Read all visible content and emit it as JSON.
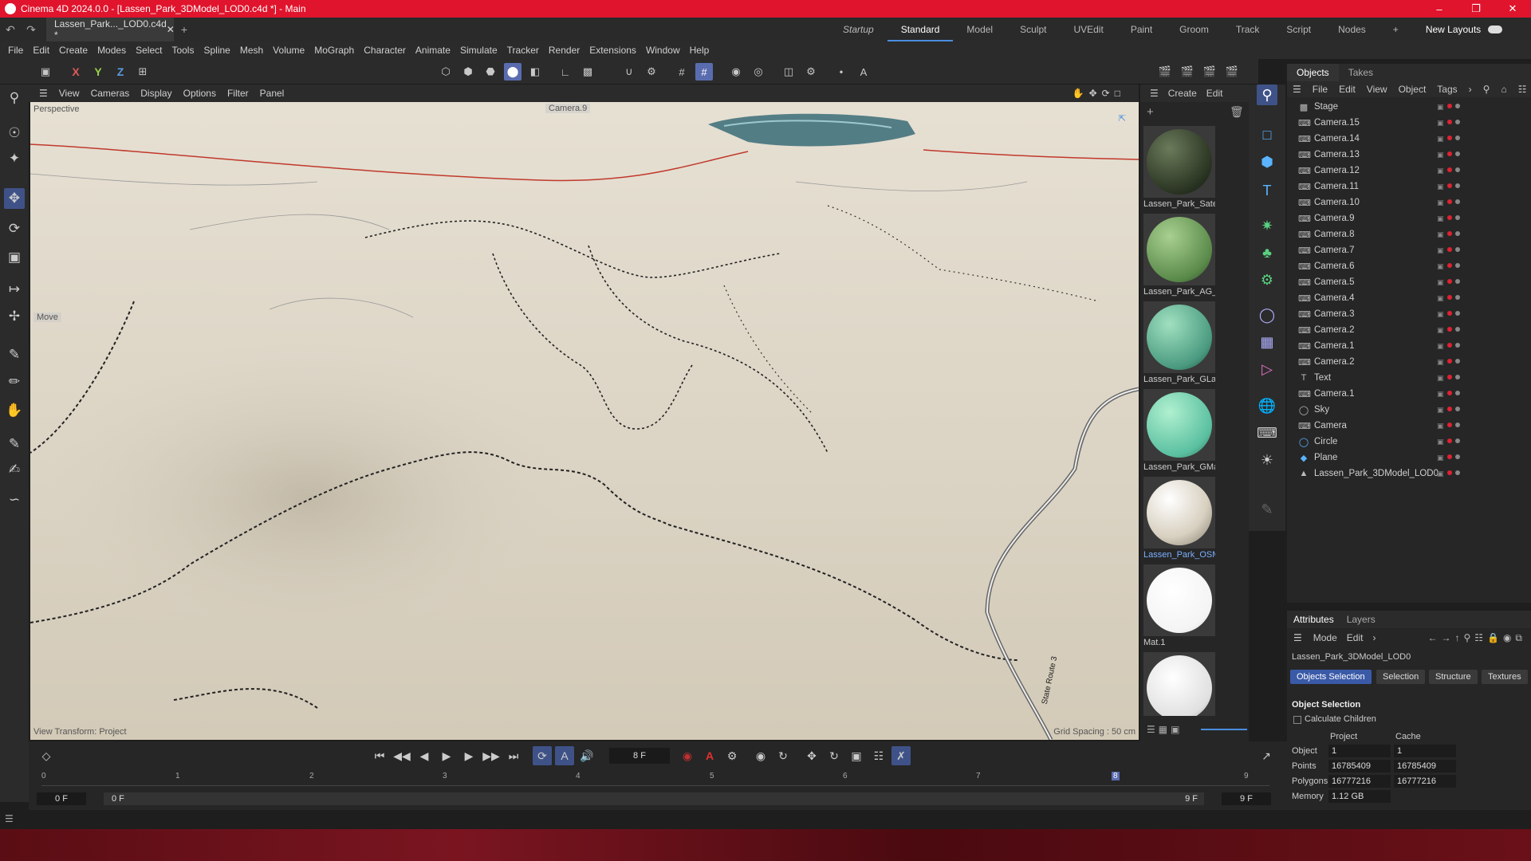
{
  "window": {
    "title": "Cinema 4D 2024.0.0 - [Lassen_Park_3DModel_LOD0.c4d *] - Main"
  },
  "doc_tab": {
    "label": "Lassen_Park..._LOD0.c4d *"
  },
  "layouts": [
    "Startup",
    "Standard",
    "Model",
    "Sculpt",
    "UVEdit",
    "Paint",
    "Groom",
    "Track",
    "Script",
    "Nodes"
  ],
  "layouts_right": {
    "plus": "+",
    "new_layouts": "New Layouts"
  },
  "menu": [
    "File",
    "Edit",
    "Create",
    "Modes",
    "Select",
    "Tools",
    "Spline",
    "Mesh",
    "Volume",
    "MoGraph",
    "Character",
    "Animate",
    "Simulate",
    "Tracker",
    "Render",
    "Extensions",
    "Window",
    "Help"
  ],
  "axes": {
    "x": "X",
    "y": "Y",
    "z": "Z"
  },
  "view_menu": [
    "View",
    "Cameras",
    "Display",
    "Options",
    "Filter",
    "Panel"
  ],
  "viewport": {
    "label_perspective": "Perspective",
    "label_camera": "Camera.9",
    "label_move": "Move",
    "view_transform": "View Transform: Project",
    "grid_spacing": "Grid Spacing : 50 cm",
    "road_label": "State Route 3"
  },
  "materials_menu": [
    "Create",
    "Edit"
  ],
  "materials": [
    {
      "name": "Lassen_Park_Satel",
      "color": "#3c4a32"
    },
    {
      "name": "Lassen_Park_AG_L",
      "color": "#6a9a5a"
    },
    {
      "name": "Lassen_Park_GLan",
      "color": "#5aaa8a"
    },
    {
      "name": "Lassen_Park_GMa",
      "color": "#6ac4a0"
    },
    {
      "name": "Lassen_Park_OSM",
      "color": "#d8d2c0"
    },
    {
      "name": "Mat.1",
      "color": "#ffffff"
    },
    {
      "name": "",
      "color": "#e0e0e0"
    }
  ],
  "objects_tabs": [
    "Objects",
    "Takes"
  ],
  "objects_menu": [
    "File",
    "Edit",
    "View",
    "Object",
    "Tags"
  ],
  "objects": [
    {
      "name": "Stage",
      "icon": "stage-icon"
    },
    {
      "name": "Camera.15",
      "icon": "camera-icon"
    },
    {
      "name": "Camera.14",
      "icon": "camera-icon"
    },
    {
      "name": "Camera.13",
      "icon": "camera-icon"
    },
    {
      "name": "Camera.12",
      "icon": "camera-icon"
    },
    {
      "name": "Camera.11",
      "icon": "camera-icon"
    },
    {
      "name": "Camera.10",
      "icon": "camera-icon"
    },
    {
      "name": "Camera.9",
      "icon": "camera-icon"
    },
    {
      "name": "Camera.8",
      "icon": "camera-icon"
    },
    {
      "name": "Camera.7",
      "icon": "camera-icon"
    },
    {
      "name": "Camera.6",
      "icon": "camera-icon"
    },
    {
      "name": "Camera.5",
      "icon": "camera-icon"
    },
    {
      "name": "Camera.4",
      "icon": "camera-icon"
    },
    {
      "name": "Camera.3",
      "icon": "camera-icon"
    },
    {
      "name": "Camera.2",
      "icon": "camera-icon"
    },
    {
      "name": "Camera.1",
      "icon": "camera-icon"
    },
    {
      "name": "Camera.2",
      "icon": "camera-icon"
    },
    {
      "name": "Text",
      "icon": "text-icon"
    },
    {
      "name": "Camera.1",
      "icon": "camera-icon"
    },
    {
      "name": "Sky",
      "icon": "sky-icon"
    },
    {
      "name": "Camera",
      "icon": "camera-icon"
    },
    {
      "name": "Circle",
      "icon": "circle-icon"
    },
    {
      "name": "Plane",
      "icon": "plane-icon"
    },
    {
      "name": "Lassen_Park_3DModel_LOD0",
      "icon": "polygon-icon"
    }
  ],
  "attributes": {
    "tabs": [
      "Attributes",
      "Layers"
    ],
    "menu": [
      "Mode",
      "Edit"
    ],
    "object_name": "Lassen_Park_3DModel_LOD0",
    "subtabs": [
      "Objects Selection",
      "Selection",
      "Structure",
      "Textures"
    ],
    "section": "Object Selection",
    "calc_children": "Calculate Children",
    "col_project": "Project",
    "col_cache": "Cache",
    "rows": [
      {
        "label": "Object",
        "project": "1",
        "cache": "1"
      },
      {
        "label": "Points",
        "project": "16785409",
        "cache": "16785409"
      },
      {
        "label": "Polygons",
        "project": "16777216",
        "cache": "16777216"
      },
      {
        "label": "Memory",
        "project": "1.12 GB",
        "cache": ""
      }
    ]
  },
  "timeline": {
    "current_frame": "8 F",
    "ticks": [
      "0",
      "1",
      "2",
      "3",
      "4",
      "5",
      "6",
      "7",
      "8",
      "9"
    ],
    "start": "0 F",
    "start2": "0 F",
    "end": "9 F",
    "end2": "9 F"
  }
}
